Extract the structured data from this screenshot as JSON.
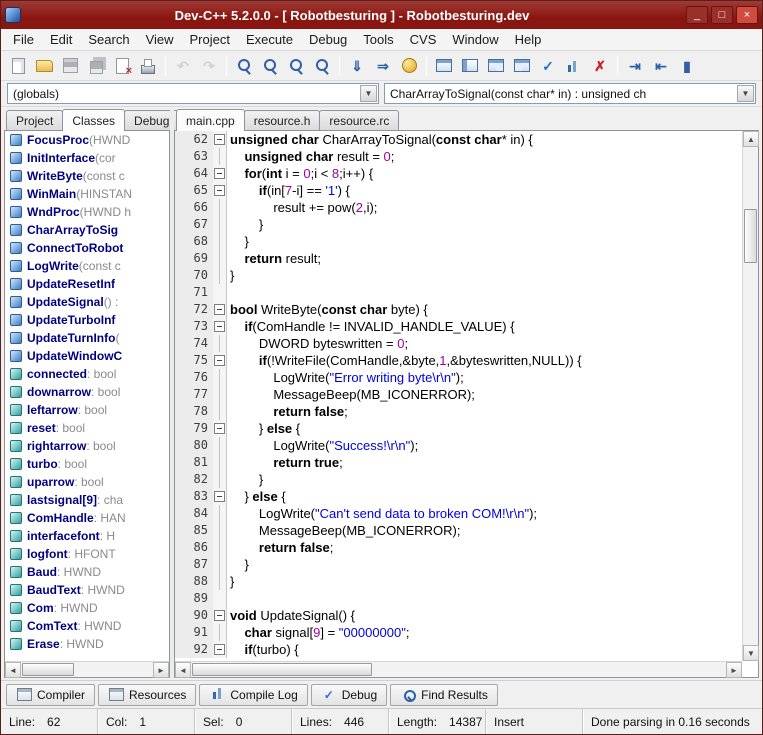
{
  "colors": {
    "titlebar": "#8a1612",
    "titlebar_text": "#ffffff",
    "close_button": "#d14b41",
    "keyword": "#000000",
    "string": "#0000dd",
    "number": "#a000a0",
    "tree_name": "#000080"
  },
  "window": {
    "title": "Dev-C++ 5.2.0.0 - [ Robotbesturing ] - Robotbesturing.dev",
    "minimize_glyph": "_",
    "maximize_glyph": "□",
    "close_glyph": "×"
  },
  "menu": {
    "items": [
      "File",
      "Edit",
      "Search",
      "View",
      "Project",
      "Execute",
      "Debug",
      "Tools",
      "CVS",
      "Window",
      "Help"
    ]
  },
  "toolbar": {
    "buttons": [
      {
        "name": "new-source-button",
        "kind": "page"
      },
      {
        "name": "open-project-button",
        "kind": "open"
      },
      {
        "name": "save-button",
        "kind": "floppy",
        "disabled": true
      },
      {
        "name": "save-all-button",
        "kind": "floppy2",
        "disabled": true
      },
      {
        "name": "close-file-button",
        "kind": "pagex"
      },
      {
        "name": "print-button",
        "kind": "print"
      },
      {
        "sep": true
      },
      {
        "name": "undo-button",
        "kind": "glyph",
        "glyph": "↶",
        "color": "#a7b0b8",
        "disabled": true
      },
      {
        "name": "redo-button",
        "kind": "glyph",
        "glyph": "↷",
        "color": "#a7b0b8",
        "disabled": true
      },
      {
        "sep": true
      },
      {
        "name": "find-button",
        "kind": "mag"
      },
      {
        "name": "replace-button",
        "kind": "mag"
      },
      {
        "name": "find-next-button",
        "kind": "mag"
      },
      {
        "name": "goto-line-button",
        "kind": "mag"
      },
      {
        "sep": true
      },
      {
        "name": "compile-button",
        "kind": "glyph",
        "glyph": "⇓",
        "color": "#2f5fa8"
      },
      {
        "name": "run-button",
        "kind": "glyph",
        "glyph": "⇒",
        "color": "#2f5fa8"
      },
      {
        "name": "compile-run-button",
        "kind": "ball"
      },
      {
        "sep": true
      },
      {
        "name": "window-layout-1-button",
        "kind": "grid"
      },
      {
        "name": "window-layout-2-button",
        "kind": "grid2"
      },
      {
        "name": "window-layout-3-button",
        "kind": "grid3"
      },
      {
        "name": "window-layout-4-button",
        "kind": "grid4"
      },
      {
        "name": "syntax-check-button",
        "kind": "glyph",
        "glyph": "✓",
        "color": "#2b6fd4"
      },
      {
        "name": "profile-button",
        "kind": "chart"
      },
      {
        "name": "abort-button",
        "kind": "glyph",
        "glyph": "✗",
        "color": "#cc2222"
      },
      {
        "sep": true
      },
      {
        "name": "goto-function-button",
        "kind": "glyph",
        "glyph": "⇥",
        "color": "#2f5fa8"
      },
      {
        "name": "jump-back-button",
        "kind": "glyph",
        "glyph": "⇤",
        "color": "#2f5fa8"
      },
      {
        "name": "insert-button",
        "kind": "glyph",
        "glyph": "▮",
        "color": "#2f5fa8"
      }
    ]
  },
  "navigation": {
    "scope_combo": "(globals)",
    "member_combo": "CharArrayToSignal(const char* in) : unsigned ch",
    "dropdown_glyph": "▼"
  },
  "left_panel": {
    "tabs": [
      "Project",
      "Classes",
      "Debug"
    ],
    "active_tab": "Classes",
    "items": [
      {
        "name": "FocusProc",
        "sig": "(HWND",
        "kind": "method"
      },
      {
        "name": "InitInterface",
        "sig": "(cor",
        "kind": "method"
      },
      {
        "name": "WriteByte",
        "sig": "(const c",
        "kind": "method"
      },
      {
        "name": "WinMain",
        "sig": "(HINSTAN",
        "kind": "method"
      },
      {
        "name": "WndProc",
        "sig": "(HWND h",
        "kind": "method"
      },
      {
        "name": "CharArrayToSig",
        "sig": "",
        "kind": "method"
      },
      {
        "name": "ConnectToRobot",
        "sig": "",
        "kind": "method"
      },
      {
        "name": "LogWrite",
        "sig": "(const c",
        "kind": "method"
      },
      {
        "name": "UpdateResetInf",
        "sig": "",
        "kind": "method"
      },
      {
        "name": "UpdateSignal",
        "sig": "() :",
        "kind": "method"
      },
      {
        "name": "UpdateTurboInf",
        "sig": "",
        "kind": "method"
      },
      {
        "name": "UpdateTurnInfo",
        "sig": "(",
        "kind": "method"
      },
      {
        "name": "UpdateWindowC",
        "sig": "",
        "kind": "method"
      },
      {
        "name": "connected",
        "sig": " : bool",
        "kind": "variable"
      },
      {
        "name": "downarrow",
        "sig": " : bool",
        "kind": "variable"
      },
      {
        "name": "leftarrow",
        "sig": " : bool",
        "kind": "variable"
      },
      {
        "name": "reset",
        "sig": " : bool",
        "kind": "variable"
      },
      {
        "name": "rightarrow",
        "sig": " : bool",
        "kind": "variable"
      },
      {
        "name": "turbo",
        "sig": " : bool",
        "kind": "variable"
      },
      {
        "name": "uparrow",
        "sig": " : bool",
        "kind": "variable"
      },
      {
        "name": "lastsignal[9]",
        "sig": " : cha",
        "kind": "variable"
      },
      {
        "name": "ComHandle",
        "sig": " : HAN",
        "kind": "variable"
      },
      {
        "name": "interfacefont",
        "sig": " : H",
        "kind": "variable"
      },
      {
        "name": "logfont",
        "sig": " : HFONT",
        "kind": "variable"
      },
      {
        "name": "Baud",
        "sig": " : HWND",
        "kind": "variable"
      },
      {
        "name": "BaudText",
        "sig": " : HWND",
        "kind": "variable"
      },
      {
        "name": "Com",
        "sig": " : HWND",
        "kind": "variable"
      },
      {
        "name": "ComText",
        "sig": " : HWND",
        "kind": "variable"
      },
      {
        "name": "Erase",
        "sig": " : HWND",
        "kind": "variable"
      }
    ]
  },
  "editor": {
    "tabs": [
      "main.cpp",
      "resource.h",
      "resource.rc"
    ],
    "active_tab": "main.cpp",
    "lines": [
      {
        "n": 62,
        "f": "b",
        "tk": [
          [
            "k",
            "unsigned"
          ],
          [
            "t",
            " "
          ],
          [
            "k",
            "char"
          ],
          [
            "t",
            " CharArrayToSignal("
          ],
          [
            "k",
            "const"
          ],
          [
            "t",
            " "
          ],
          [
            "k",
            "char"
          ],
          [
            "t",
            "* in) {"
          ]
        ]
      },
      {
        "n": 63,
        "f": "l",
        "tk": [
          [
            "t",
            "    "
          ],
          [
            "k",
            "unsigned"
          ],
          [
            "t",
            " "
          ],
          [
            "k",
            "char"
          ],
          [
            "t",
            " result = "
          ],
          [
            "d",
            "0"
          ],
          [
            "t",
            ";"
          ]
        ]
      },
      {
        "n": 64,
        "f": "b",
        "tk": [
          [
            "t",
            "    "
          ],
          [
            "k",
            "for"
          ],
          [
            "t",
            "("
          ],
          [
            "k",
            "int"
          ],
          [
            "t",
            " i = "
          ],
          [
            "d",
            "0"
          ],
          [
            "t",
            ";i < "
          ],
          [
            "d",
            "8"
          ],
          [
            "t",
            ";i++) {"
          ]
        ]
      },
      {
        "n": 65,
        "f": "b",
        "tk": [
          [
            "t",
            "        "
          ],
          [
            "k",
            "if"
          ],
          [
            "t",
            "(in["
          ],
          [
            "d",
            "7"
          ],
          [
            "t",
            "-i] == "
          ],
          [
            "s",
            "'1'"
          ],
          [
            "t",
            ") {"
          ]
        ]
      },
      {
        "n": 66,
        "f": "l",
        "tk": [
          [
            "t",
            "            result += pow("
          ],
          [
            "d",
            "2"
          ],
          [
            "t",
            ",i);"
          ]
        ]
      },
      {
        "n": 67,
        "f": "l",
        "tk": [
          [
            "t",
            "        }"
          ]
        ]
      },
      {
        "n": 68,
        "f": "l",
        "tk": [
          [
            "t",
            "    }"
          ]
        ]
      },
      {
        "n": 69,
        "f": "l",
        "tk": [
          [
            "t",
            "    "
          ],
          [
            "k",
            "return"
          ],
          [
            "t",
            " result;"
          ]
        ]
      },
      {
        "n": 70,
        "f": "l",
        "tk": [
          [
            "t",
            "}"
          ]
        ]
      },
      {
        "n": 71,
        "f": "",
        "tk": []
      },
      {
        "n": 72,
        "f": "b",
        "tk": [
          [
            "k",
            "bool"
          ],
          [
            "t",
            " WriteByte("
          ],
          [
            "k",
            "const"
          ],
          [
            "t",
            " "
          ],
          [
            "k",
            "char"
          ],
          [
            "t",
            " byte) {"
          ]
        ]
      },
      {
        "n": 73,
        "f": "b",
        "tk": [
          [
            "t",
            "    "
          ],
          [
            "k",
            "if"
          ],
          [
            "t",
            "(ComHandle != INVALID_HANDLE_VALUE) {"
          ]
        ]
      },
      {
        "n": 74,
        "f": "l",
        "tk": [
          [
            "t",
            "        DWORD byteswritten = "
          ],
          [
            "d",
            "0"
          ],
          [
            "t",
            ";"
          ]
        ]
      },
      {
        "n": 75,
        "f": "b",
        "tk": [
          [
            "t",
            "        "
          ],
          [
            "k",
            "if"
          ],
          [
            "t",
            "(!WriteFile(ComHandle,&byte,"
          ],
          [
            "d",
            "1"
          ],
          [
            "t",
            ",&byteswritten,NULL)) {"
          ]
        ]
      },
      {
        "n": 76,
        "f": "l",
        "tk": [
          [
            "t",
            "            LogWrite("
          ],
          [
            "s",
            "\"Error writing byte\\r\\n\""
          ],
          [
            "t",
            ");"
          ]
        ]
      },
      {
        "n": 77,
        "f": "l",
        "tk": [
          [
            "t",
            "            MessageBeep(MB_ICONERROR);"
          ]
        ]
      },
      {
        "n": 78,
        "f": "l",
        "tk": [
          [
            "t",
            "            "
          ],
          [
            "k",
            "return"
          ],
          [
            "t",
            " "
          ],
          [
            "k",
            "false"
          ],
          [
            "t",
            ";"
          ]
        ]
      },
      {
        "n": 79,
        "f": "b",
        "tk": [
          [
            "t",
            "        } "
          ],
          [
            "k",
            "else"
          ],
          [
            "t",
            " {"
          ]
        ]
      },
      {
        "n": 80,
        "f": "l",
        "tk": [
          [
            "t",
            "            LogWrite("
          ],
          [
            "s",
            "\"Success!\\r\\n\""
          ],
          [
            "t",
            ");"
          ]
        ]
      },
      {
        "n": 81,
        "f": "l",
        "tk": [
          [
            "t",
            "            "
          ],
          [
            "k",
            "return"
          ],
          [
            "t",
            " "
          ],
          [
            "k",
            "true"
          ],
          [
            "t",
            ";"
          ]
        ]
      },
      {
        "n": 82,
        "f": "l",
        "tk": [
          [
            "t",
            "        }"
          ]
        ]
      },
      {
        "n": 83,
        "f": "b",
        "tk": [
          [
            "t",
            "    } "
          ],
          [
            "k",
            "else"
          ],
          [
            "t",
            " {"
          ]
        ]
      },
      {
        "n": 84,
        "f": "l",
        "tk": [
          [
            "t",
            "        LogWrite("
          ],
          [
            "s",
            "\"Can't send data to broken COM!\\r\\n\""
          ],
          [
            "t",
            ");"
          ]
        ]
      },
      {
        "n": 85,
        "f": "l",
        "tk": [
          [
            "t",
            "        MessageBeep(MB_ICONERROR);"
          ]
        ]
      },
      {
        "n": 86,
        "f": "l",
        "tk": [
          [
            "t",
            "        "
          ],
          [
            "k",
            "return"
          ],
          [
            "t",
            " "
          ],
          [
            "k",
            "false"
          ],
          [
            "t",
            ";"
          ]
        ]
      },
      {
        "n": 87,
        "f": "l",
        "tk": [
          [
            "t",
            "    }"
          ]
        ]
      },
      {
        "n": 88,
        "f": "l",
        "tk": [
          [
            "t",
            "}"
          ]
        ]
      },
      {
        "n": 89,
        "f": "",
        "tk": []
      },
      {
        "n": 90,
        "f": "b",
        "tk": [
          [
            "k",
            "void"
          ],
          [
            "t",
            " UpdateSignal() {"
          ]
        ]
      },
      {
        "n": 91,
        "f": "l",
        "tk": [
          [
            "t",
            "    "
          ],
          [
            "k",
            "char"
          ],
          [
            "t",
            " signal["
          ],
          [
            "d",
            "9"
          ],
          [
            "t",
            "] = "
          ],
          [
            "s",
            "\"00000000\""
          ],
          [
            "t",
            ";"
          ]
        ]
      },
      {
        "n": 92,
        "f": "b",
        "tk": [
          [
            "t",
            "    "
          ],
          [
            "k",
            "if"
          ],
          [
            "t",
            "(turbo) {"
          ]
        ]
      }
    ]
  },
  "bottom_tabs": [
    {
      "label": "Compiler",
      "kind": "window"
    },
    {
      "label": "Resources",
      "kind": "window"
    },
    {
      "label": "Compile Log",
      "kind": "chart"
    },
    {
      "label": "Debug",
      "kind": "glyph",
      "glyph": "✓",
      "color": "#2b6fd4"
    },
    {
      "label": "Find Results",
      "kind": "mag"
    }
  ],
  "status_bar": {
    "cells": [
      {
        "name": "status-line",
        "label": "Line:",
        "value": "62"
      },
      {
        "name": "status-col",
        "label": "Col:",
        "value": "1"
      },
      {
        "name": "status-sel",
        "label": "Sel:",
        "value": "0"
      },
      {
        "name": "status-lines",
        "label": "Lines:",
        "value": "446"
      },
      {
        "name": "status-length",
        "label": "Length:",
        "value": "14387"
      },
      {
        "name": "status-insert-mode",
        "label": "",
        "value": "Insert"
      },
      {
        "name": "status-message",
        "label": "",
        "value": "Done parsing in 0.16 seconds"
      }
    ]
  },
  "scrollbar_glyphs": {
    "up": "▲",
    "down": "▼",
    "left": "◄",
    "right": "►"
  }
}
